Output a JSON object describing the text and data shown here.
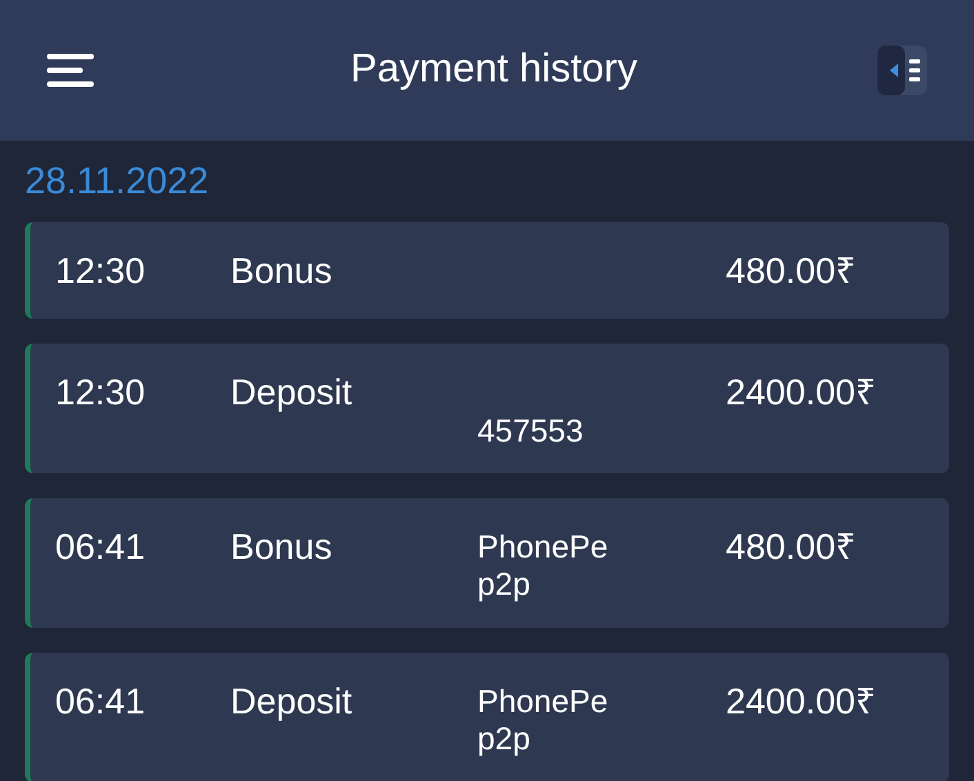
{
  "header": {
    "title": "Payment history"
  },
  "date": "28.11.2022",
  "transactions": [
    {
      "time": "12:30",
      "type": "Bonus",
      "amount": "480.00₹"
    },
    {
      "time": "12:30",
      "type": "Deposit",
      "reference": "457553",
      "amount": "2400.00₹"
    },
    {
      "time": "06:41",
      "type": "Bonus",
      "method": "PhonePe p2p",
      "amount": "480.00₹"
    },
    {
      "time": "06:41",
      "type": "Deposit",
      "method": "PhonePe p2p",
      "amount": "2400.00₹"
    }
  ]
}
